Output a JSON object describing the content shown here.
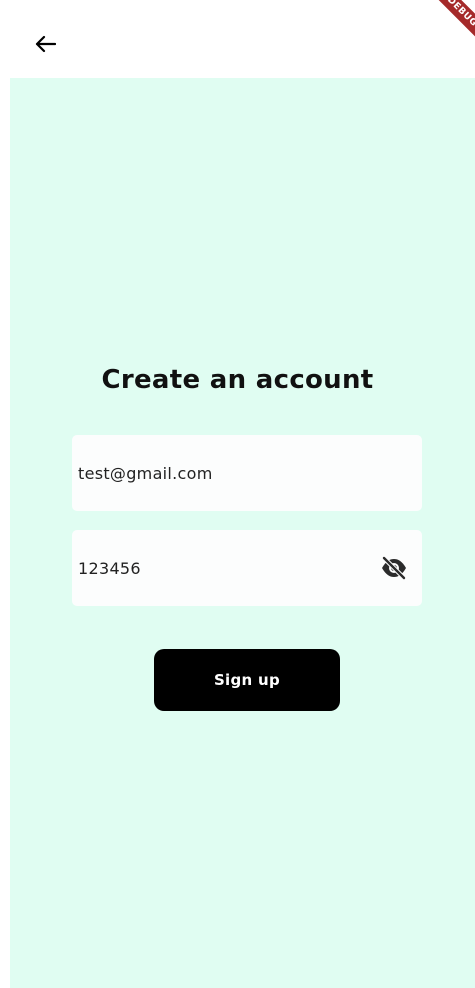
{
  "app_bar": {
    "back_icon": "arrow-left-icon",
    "debug_banner": "DEBUG"
  },
  "main": {
    "title": "Create an account",
    "email_field": {
      "value": "test@gmail.com"
    },
    "password_field": {
      "value": "123456",
      "visibility_icon": "eye-off-icon"
    },
    "signup_button": {
      "label": "Sign up"
    }
  },
  "colors": {
    "background": "#e0fdf2",
    "field_background": "#fcfdfd",
    "button_background": "#000000",
    "button_text": "#ffffff",
    "debug_banner": "#a52a2a"
  }
}
